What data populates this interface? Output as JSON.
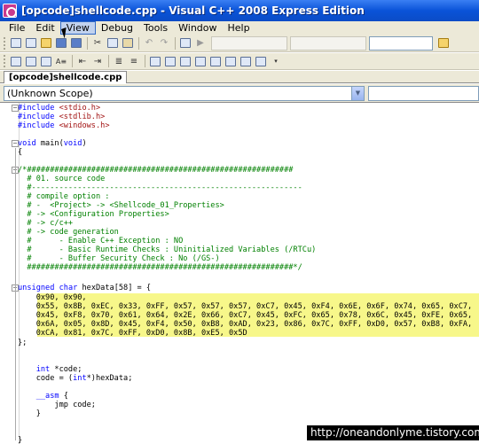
{
  "window": {
    "title": "[opcode]shellcode.cpp - Visual C++ 2008 Express Edition"
  },
  "menu": {
    "items": [
      "File",
      "Edit",
      "View",
      "Debug",
      "Tools",
      "Window",
      "Help"
    ],
    "active": "View"
  },
  "tab": {
    "label": "[opcode]shellcode.cpp"
  },
  "scope": {
    "value": "(Unknown Scope)"
  },
  "code": {
    "l01": "#include <stdio.h>",
    "l02": "#include <stdlib.h>",
    "l03": "#include <windows.h>",
    "l04": "void main(void)",
    "l05": "{",
    "l06": "/*##########################################################",
    "l07": "  # 01. source code",
    "l08": "  #-----------------------------------------------------------",
    "l09": "  # compile option :",
    "l10": "  # -  <Project> -> <Shellcode_01_Properties>",
    "l11": "  # -> <Configuration Properties>",
    "l12": "  # -> c/c++",
    "l13": "  # -> code generation",
    "l14": "  #      - Enable C++ Exception : NO",
    "l15": "  #      - Basic Runtime Checks : Uninitialized Variables (/RTCu)",
    "l16": "  #      - Buffer Security Check : No (/GS-)",
    "l17": "  ##########################################################*/",
    "l18": "unsigned char hexData[58] = {",
    "l19": "    0x90, 0x90,",
    "l20": "    0x55, 0x8B, 0xEC, 0x33, 0xFF, 0x57, 0x57, 0x57, 0xC7, 0x45, 0xF4, 0x6E, 0x6F, 0x74, 0x65, 0xC7,",
    "l21": "    0x45, 0xF8, 0x70, 0x61, 0x64, 0x2E, 0x66, 0xC7, 0x45, 0xFC, 0x65, 0x78, 0x6C, 0x45, 0xFE, 0x65,",
    "l22": "    0x6A, 0x05, 0x8D, 0x45, 0xF4, 0x50, 0xB8, 0xAD, 0x23, 0x86, 0x7C, 0xFF, 0xD0, 0x57, 0xB8, 0xFA,",
    "l23": "    0xCA, 0x81, 0x7C, 0xFF, 0xD0, 0x8B, 0xE5, 0x5D",
    "l24": "};",
    "l25": "    int *code;",
    "l26": "    code = (int*)hexData;",
    "l27": "    __asm {",
    "l28": "        jmp code;",
    "l29": "    }",
    "l30": "}"
  },
  "watermark": {
    "text": "http://oneandonlyme.tistory.com"
  }
}
